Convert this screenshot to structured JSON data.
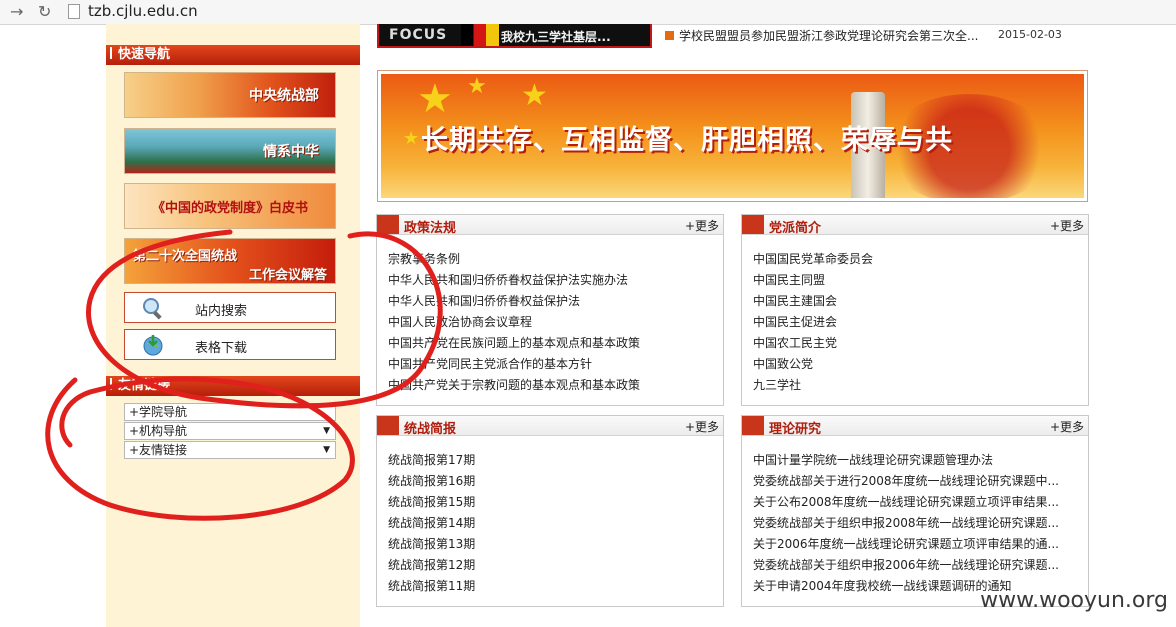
{
  "browser": {
    "url": "tzb.cjlu.edu.cn"
  },
  "quick_nav": {
    "title": "快速导航",
    "banners": [
      {
        "label": "中央统战部"
      },
      {
        "label": "情系中华"
      },
      {
        "label": "《中国的政党制度》白皮书"
      },
      {
        "label_line1": "第二十次全国统战",
        "label_line2": "工作会议解答"
      }
    ],
    "tools": [
      {
        "label": "站内搜索",
        "icon": "magnifier-icon"
      },
      {
        "label": "表格下载",
        "icon": "download-globe-icon"
      }
    ]
  },
  "links_section": {
    "title": "友情链接",
    "selects": [
      {
        "value": "+学院导航"
      },
      {
        "value": "+机构导航"
      },
      {
        "value": "+友情链接"
      }
    ]
  },
  "focus": {
    "logo": "FOCUS",
    "caption": "我校九三学社基层..."
  },
  "top_news": {
    "title": "学校民盟盟员参加民盟浙江参政党理论研究会第三次全...",
    "date": "2015-02-03"
  },
  "main_banner": {
    "slogan": "长期共存、互相监督、肝胆相照、荣辱与共"
  },
  "more_label": "+更多",
  "panels": {
    "policy": {
      "title": "政策法规",
      "items": [
        "宗教事务条例",
        "中华人民共和国归侨侨眷权益保护法实施办法",
        "中华人民共和国归侨侨眷权益保护法",
        "中国人民政治协商会议章程",
        "中国共产党在民族问题上的基本观点和基本政策",
        "中国共产党同民主党派合作的基本方针",
        "中国共产党关于宗教问题的基本观点和基本政策"
      ]
    },
    "parties": {
      "title": "党派简介",
      "items": [
        "中国国民党革命委员会",
        "中国民主同盟",
        "中国民主建国会",
        "中国民主促进会",
        "中国农工民主党",
        "中国致公党",
        "九三学社"
      ]
    },
    "briefs": {
      "title": "统战简报",
      "items": [
        "统战简报第17期",
        "统战简报第16期",
        "统战简报第15期",
        "统战简报第14期",
        "统战简报第13期",
        "统战简报第12期",
        "统战简报第11期"
      ]
    },
    "theory": {
      "title": "理论研究",
      "items": [
        "中国计量学院统一战线理论研究课题管理办法",
        "党委统战部关于进行2008年度统一战线理论研究课题中...",
        "关于公布2008年度统一战线理论研究课题立项评审结果...",
        "党委统战部关于组织申报2008年统一战线理论研究课题...",
        "关于2006年度统一战线理论研究课题立项评审结果的通...",
        "党委统战部关于组织申报2006年统一战线理论研究课题...",
        "关于申请2004年度我校统一战线课题调研的通知"
      ]
    }
  },
  "watermark": "www.wooyun.org",
  "colors": {
    "accent_red": "#c8351b",
    "sidebar_bg": "#fff3d6",
    "annotation_red": "#e0201c"
  }
}
